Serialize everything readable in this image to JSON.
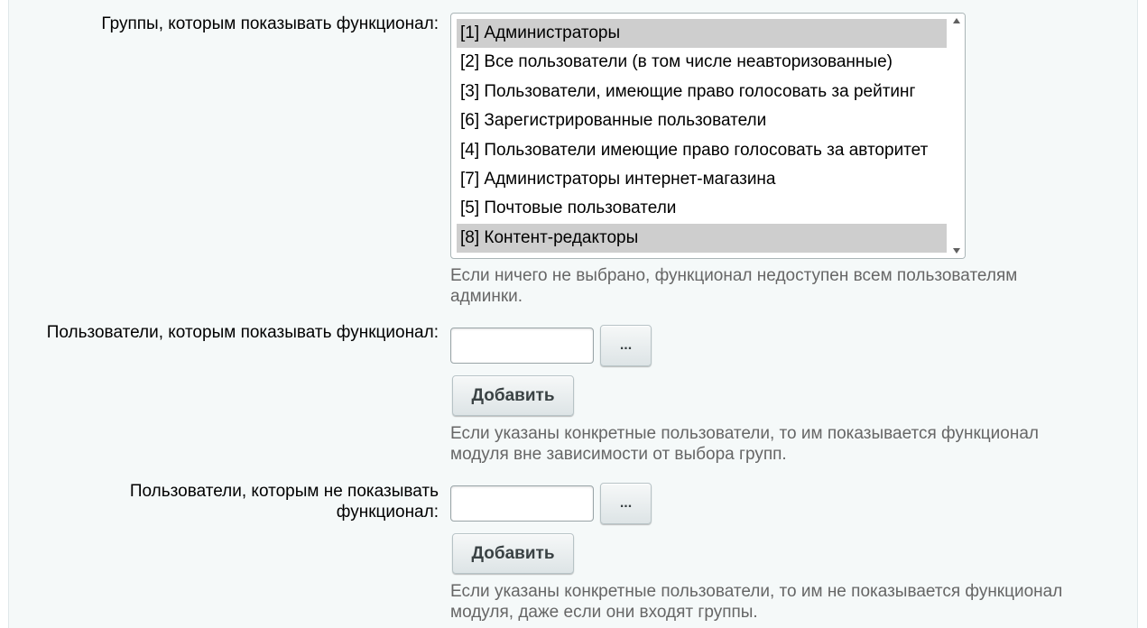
{
  "groups": {
    "label": "Группы, которым показывать функционал:",
    "options": [
      {
        "label": "[1] Администраторы",
        "selected": true
      },
      {
        "label": "[2] Все пользователи (в том числе неавторизованные)",
        "selected": false
      },
      {
        "label": "[3] Пользователи, имеющие право голосовать за рейтинг",
        "selected": false
      },
      {
        "label": "[6] Зарегистрированные пользователи",
        "selected": false
      },
      {
        "label": "[4] Пользователи имеющие право голосовать за авторитет",
        "selected": false
      },
      {
        "label": "[7] Администраторы интернет-магазина",
        "selected": false
      },
      {
        "label": "[5] Почтовые пользователи",
        "selected": false
      },
      {
        "label": "[8] Контент-редакторы",
        "selected": true
      }
    ],
    "hint_line1": "Если ничего не выбрано, функционал недоступен всем пользователям",
    "hint_line2": "админки."
  },
  "show_users": {
    "label": "Пользователи, которым показывать функционал:",
    "input_value": "",
    "browse_label": "...",
    "add_label": "Добавить",
    "hint_line1": "Если указаны конкретные пользователи, то им показывается функционал",
    "hint_line2": "модуля вне зависимости от выбора групп."
  },
  "hide_users": {
    "label_line1": "Пользователи, которым не показывать",
    "label_line2": "функционал:",
    "input_value": "",
    "browse_label": "...",
    "add_label": "Добавить",
    "hint_line1": "Если указаны конкретные пользователи, то им не показывается функционал",
    "hint_line2": "модуля, даже если они входят группы."
  }
}
